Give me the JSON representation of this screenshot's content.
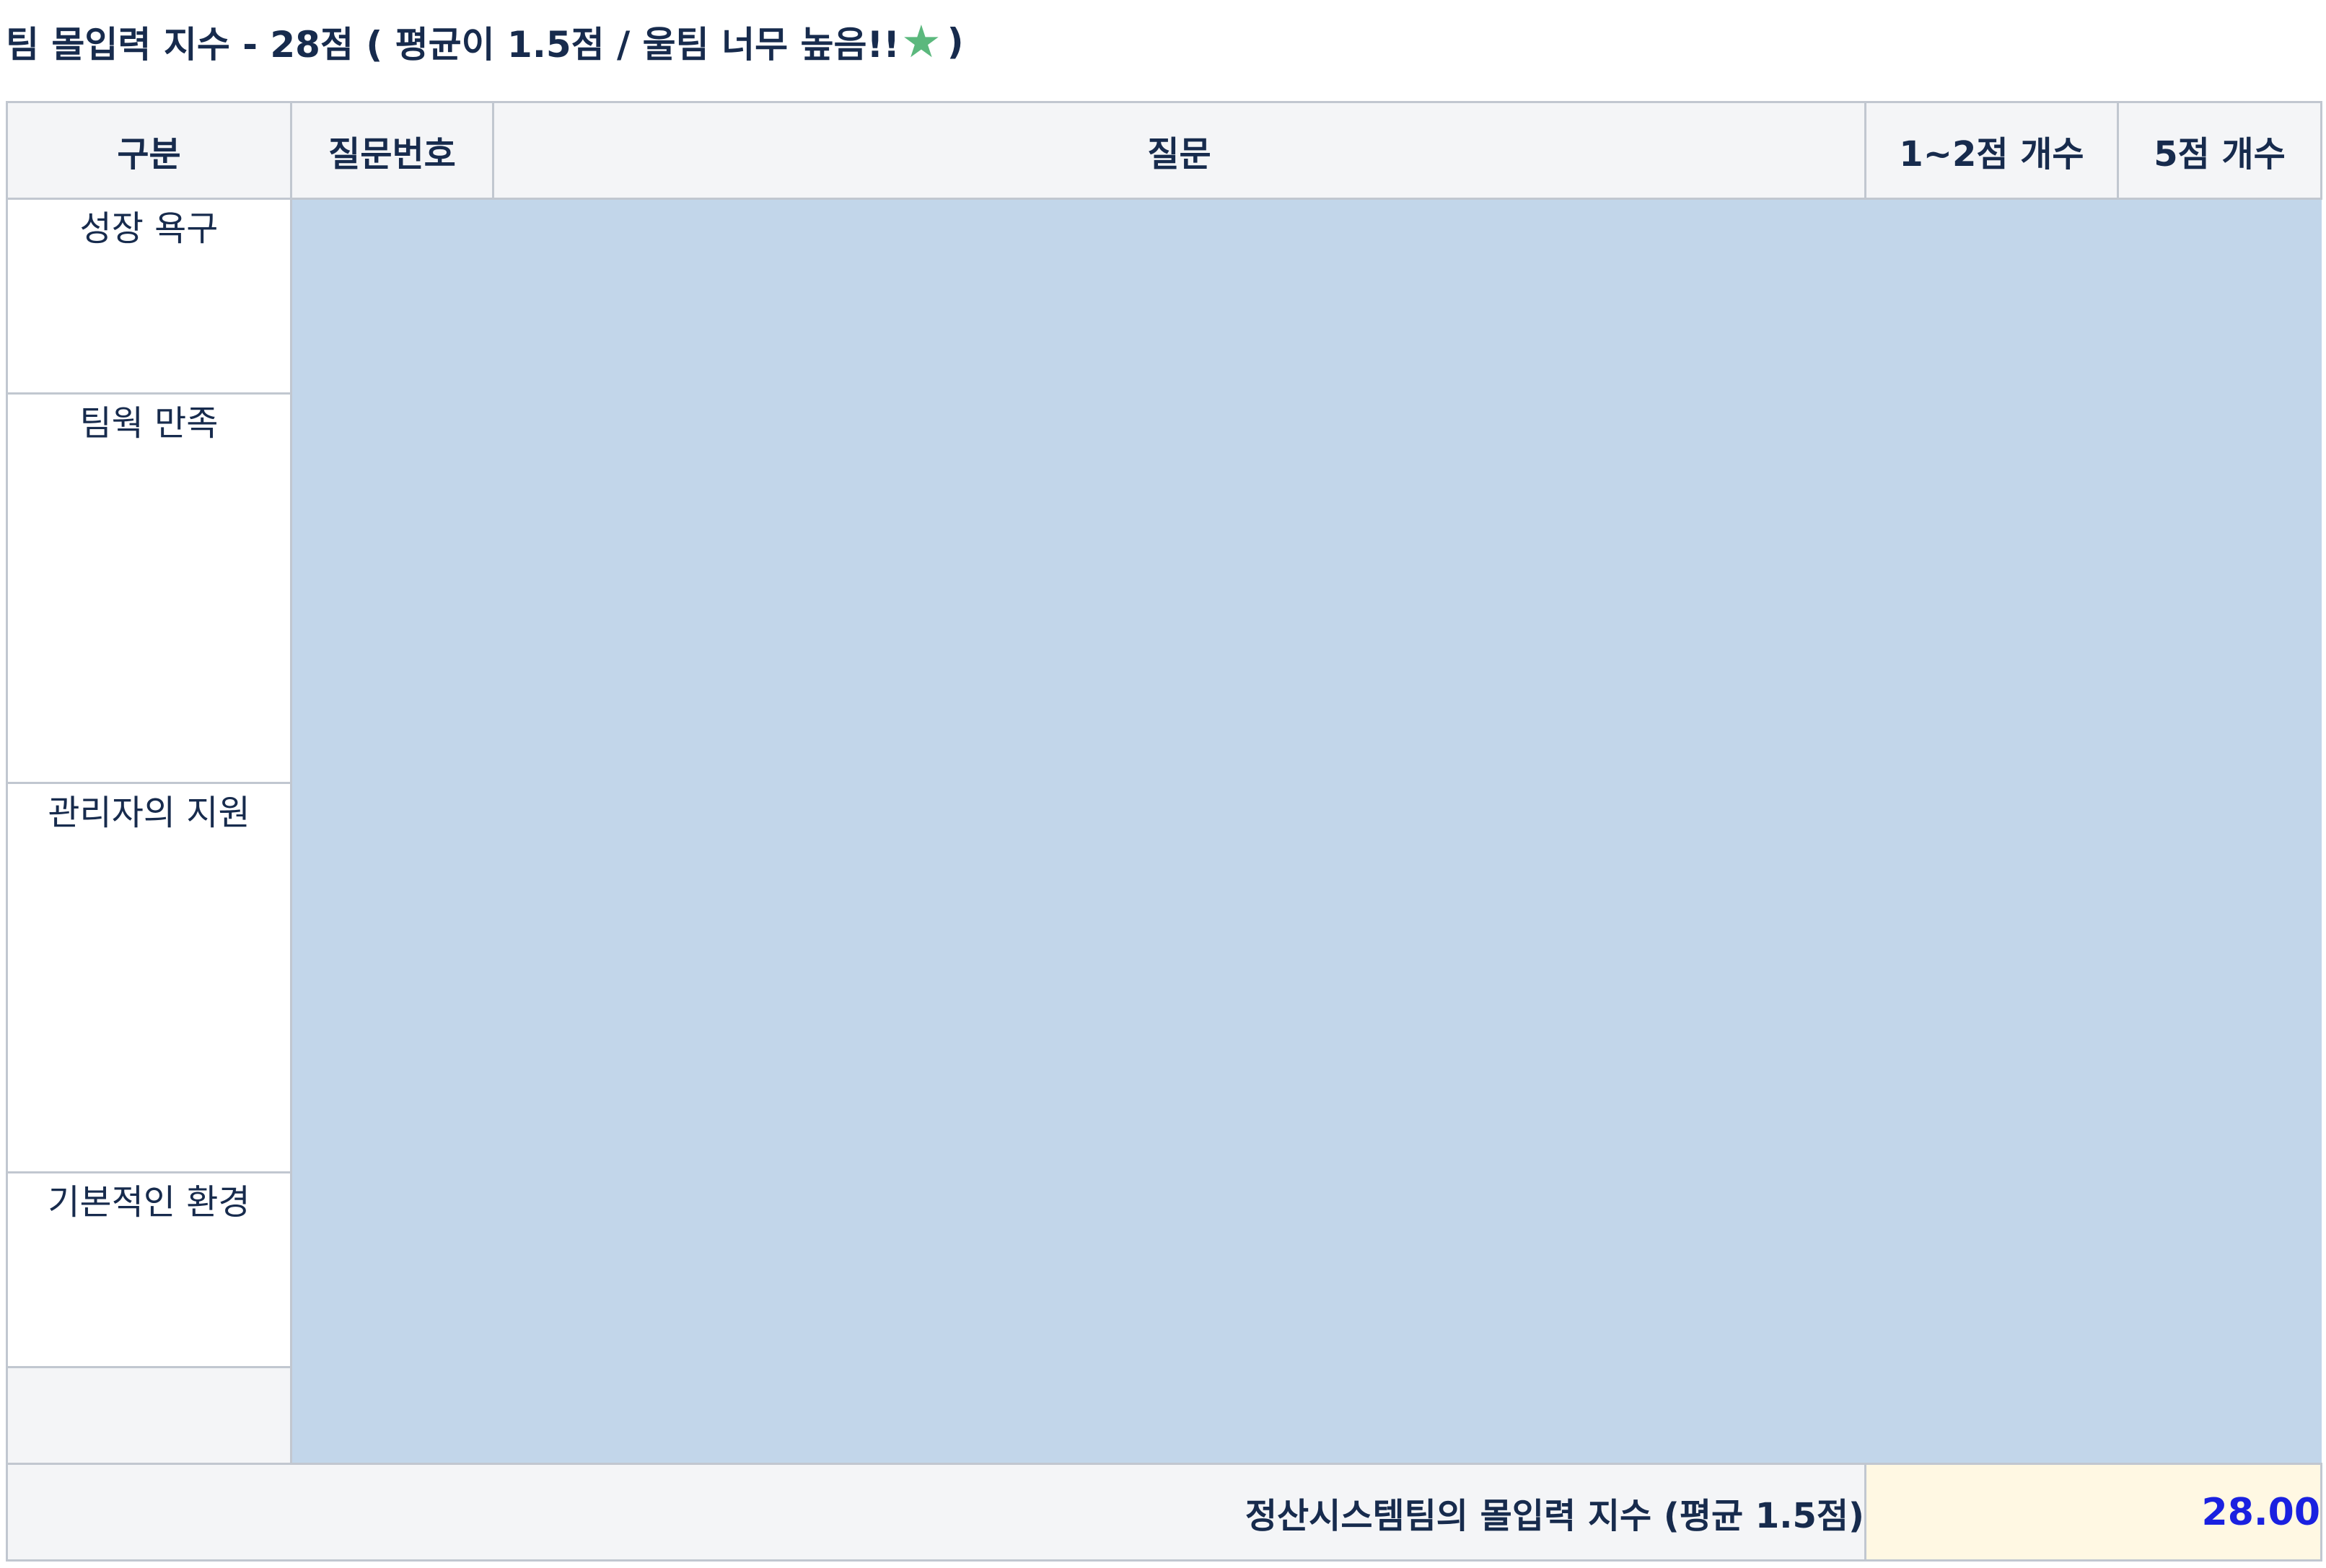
{
  "title": {
    "prefix": "팀 몰입력 지수 - 28점 ( 평균이 1.5점 / 울팀 너무 높음!!",
    "star_icon": "star-icon",
    "star_color": "#5bb87d",
    "suffix": ")"
  },
  "table": {
    "headers": {
      "category": "구분",
      "question_no": "질문번호",
      "question": "질문",
      "count_1_2": "1~2점 개수",
      "count_5": "5점 개수"
    },
    "rows": [
      {
        "category": "성장 욕구"
      },
      {
        "category": "팀웍 만족"
      },
      {
        "category": "관리자의 지원"
      },
      {
        "category": "기본적인 환경"
      },
      {
        "category": ""
      }
    ],
    "masked_region_color": "#c2d6ea",
    "footer": {
      "label": "정산시스템팀의 몰입력 지수 (평균 1.5점)",
      "value": "28.00",
      "value_color": "#1a21e0"
    }
  }
}
